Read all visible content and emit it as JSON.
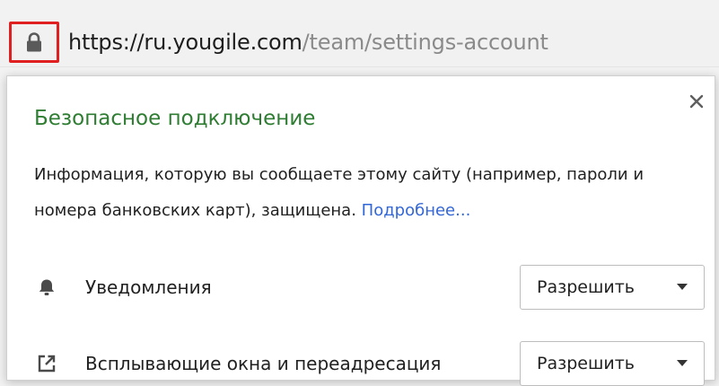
{
  "address_bar": {
    "url_domain": "https://ru.yougile.com",
    "url_path": "/team/settings-account",
    "lock_icon": "lock-icon",
    "highlight_color": "#e02020"
  },
  "popup": {
    "title": "Безопасное подключение",
    "title_color": "#2e7d32",
    "description": "Информация, которую вы сообщаете этому сайту (например, пароли и номера банковских карт), защищена.",
    "learn_more": "Подробнее...",
    "link_color": "#3367d6",
    "close_icon": "close-icon",
    "permissions": [
      {
        "icon": "bell-icon",
        "label": "Уведомления",
        "value": "Разрешить"
      },
      {
        "icon": "popup-redirect-icon",
        "label": "Всплывающие окна и переадресация",
        "value": "Разрешить"
      }
    ]
  }
}
